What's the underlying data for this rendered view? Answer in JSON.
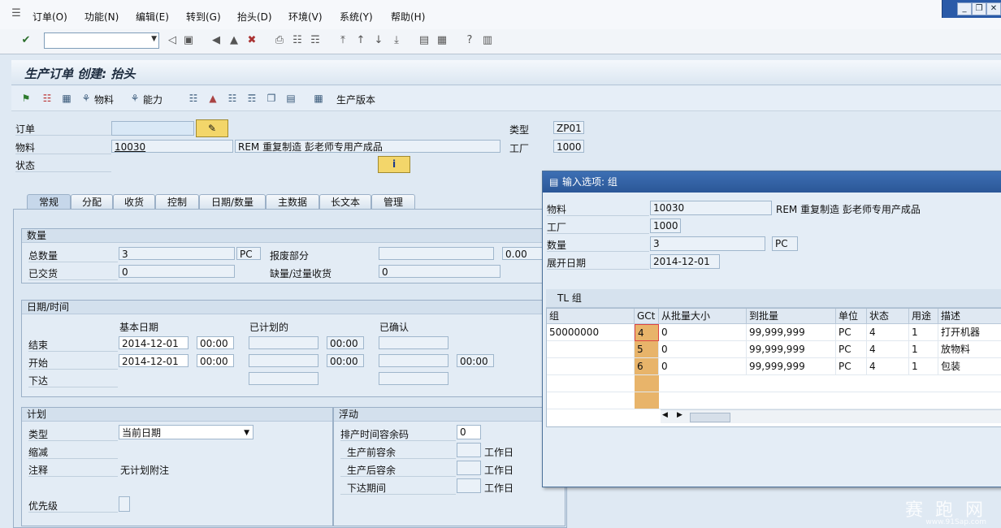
{
  "menu": {
    "items": [
      "订单(O)",
      "功能(N)",
      "编辑(E)",
      "转到(G)",
      "抬头(D)",
      "环境(V)",
      "系统(Y)",
      "帮助(H)"
    ]
  },
  "page_title": "生产订单 创建: 抬头",
  "app_toolbar": {
    "material_label": "物料",
    "capacity_label": "能力",
    "production_version_label": "生产版本"
  },
  "header": {
    "order_label": "订单",
    "order_value": "",
    "material_label": "物料",
    "material_value": "10030",
    "material_desc": "REM 重复制造 彭老师专用产成品",
    "status_label": "状态",
    "type_label": "类型",
    "type_value": "ZP01",
    "plant_label": "工厂",
    "plant_value": "1000"
  },
  "tabs": [
    "常规",
    "分配",
    "收货",
    "控制",
    "日期/数量",
    "主数据",
    "长文本",
    "管理"
  ],
  "quantity_group": {
    "title": "数量",
    "total_qty_label": "总数量",
    "total_qty_value": "3",
    "total_qty_unit": "PC",
    "scrap_label": "报废部分",
    "scrap_value": "",
    "scrap_pct": "0.00",
    "delivered_label": "已交货",
    "delivered_value": "0",
    "short_over_label": "缺量/过量收货",
    "short_over_value": "0"
  },
  "dates_group": {
    "title": "日期/时间",
    "basic_date_label": "基本日期",
    "scheduled_label": "已计划的",
    "confirmed_label": "已确认",
    "end_label": "结束",
    "end_date": "2014-12-01",
    "end_time": "00:00",
    "end_sched_time": "00:00",
    "start_label": "开始",
    "start_date": "2014-12-01",
    "start_time": "00:00",
    "start_sched_time": "00:00",
    "start_conf_time": "00:00",
    "release_label": "下达"
  },
  "plan_group": {
    "title": "计划",
    "type_label": "类型",
    "type_value": "当前日期",
    "reduction_label": "缩减",
    "note_label": "注释",
    "note_value": "无计划附注",
    "priority_label": "优先级"
  },
  "float_group": {
    "title": "浮动",
    "sched_margin_label": "排产时间容余码",
    "sched_margin_value": "0",
    "float_before_label": "生产前容余",
    "float_after_label": "生产后容余",
    "release_period_label": "下达期间",
    "workday_unit": "工作日"
  },
  "popup": {
    "title": "输入选项: 组",
    "material_label": "物料",
    "material_value": "10030",
    "material_desc": "REM 重复制造 彭老师专用产成品",
    "plant_label": "工厂",
    "plant_value": "1000",
    "qty_label": "数量",
    "qty_value": "3",
    "qty_unit": "PC",
    "explode_date_label": "展开日期",
    "explode_date_value": "2014-12-01",
    "tl_group_title": "TL 组",
    "columns": [
      "组",
      "GCt",
      "从批量大小",
      "到批量",
      "单位",
      "状态",
      "用途",
      "描述"
    ],
    "rows": [
      {
        "group": "50000000",
        "gct": "4",
        "from": "0",
        "to": "99,999,999",
        "unit": "PC",
        "status": "4",
        "usage": "1",
        "desc": "打开机器"
      },
      {
        "group": "",
        "gct": "5",
        "from": "0",
        "to": "99,999,999",
        "unit": "PC",
        "status": "4",
        "usage": "1",
        "desc": "放物料"
      },
      {
        "group": "",
        "gct": "6",
        "from": "0",
        "to": "99,999,999",
        "unit": "PC",
        "status": "4",
        "usage": "1",
        "desc": "包装"
      }
    ]
  },
  "watermark": {
    "text": "赛 跑 网",
    "url": "www.91Sap.com"
  }
}
